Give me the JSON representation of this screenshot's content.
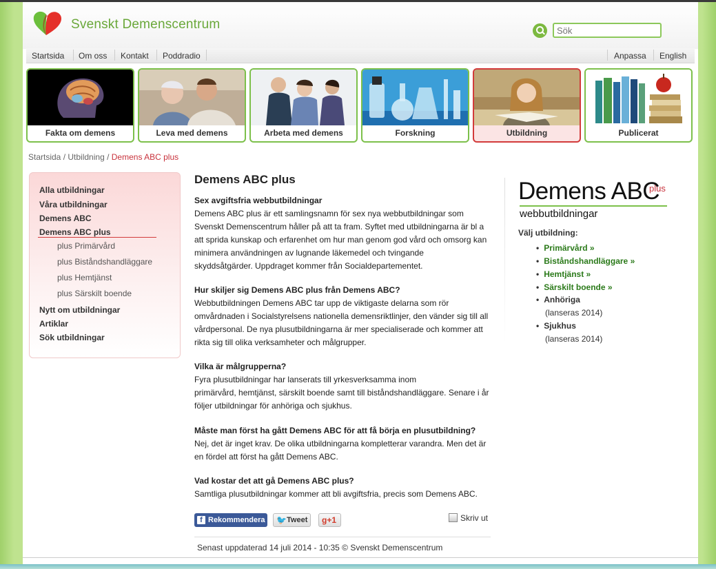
{
  "site": {
    "name": "Svenskt Demenscentrum"
  },
  "search": {
    "placeholder": "Sök"
  },
  "nav": {
    "left": [
      "Startsida",
      "Om oss",
      "Kontakt",
      "Poddradio"
    ],
    "right": [
      "Anpassa",
      "English"
    ]
  },
  "tiles": [
    {
      "label": "Fakta om demens",
      "icon": "brain-image"
    },
    {
      "label": "Leva med demens",
      "icon": "caregiver-image"
    },
    {
      "label": "Arbeta med demens",
      "icon": "nurses-image"
    },
    {
      "label": "Forskning",
      "icon": "lab-glassware-image"
    },
    {
      "label": "Utbildning",
      "icon": "student-image",
      "active": true
    },
    {
      "label": "Publicerat",
      "icon": "books-image"
    }
  ],
  "breadcrumb": {
    "items": [
      "Startsida",
      "Utbildning"
    ],
    "current": "Demens ABC plus",
    "sep": " / "
  },
  "leftmenu": {
    "items": [
      "Alla utbildningar",
      "Våra utbildningar",
      "Demens ABC",
      "Demens ABC plus"
    ],
    "subitems": [
      "plus Primärvård",
      "plus Biståndshandläggare",
      "plus Hemtjänst",
      "plus Särskilt boende"
    ],
    "items2": [
      "Nytt om utbildningar",
      "Artiklar",
      "Sök utbildningar"
    ]
  },
  "main": {
    "title": "Demens ABC plus",
    "sections": [
      {
        "heading": "Sex avgiftsfria webbutbildningar",
        "lines": [
          "Demens ABC plus är ett samlingsnamn för sex nya webbutbildningar som",
          "Svenskt Demenscentrum håller på att ta fram. Syftet med utbildningarna är bl a",
          "att sprida kunskap och erfarenhet om hur man genom god vård och omsorg kan",
          "minimera användningen av lugnande läkemedel och tvingande",
          "skyddsåtgärder. Uppdraget kommer från Socialdepartementet."
        ]
      },
      {
        "heading": "Hur skiljer sig Demens ABC plus från Demens ABC?",
        "lines": [
          "Webbutbildningen Demens ABC tar upp de viktigaste delarna som rör",
          "omvårdnaden i Socialstyrelsens nationella demensriktlinjer, den vänder sig till all",
          "vårdpersonal. De nya plusutbildningarna är mer specialiserade och kommer att",
          "rikta sig till olika verksamheter och målgrupper."
        ]
      },
      {
        "heading": "Vilka är målgrupperna?",
        "lines": [
          "Fyra plusutbildningar har lanserats till yrkesverksamma inom",
          "primärvård, hemtjänst, särskilt boende samt till biståndshandläggare. Senare i år",
          "följer utbildningar för anhöriga och sjukhus."
        ]
      },
      {
        "heading": "Måste man först ha gått Demens ABC för att få börja en plusutbildning?",
        "lines": [
          "Nej, det är inget krav. De olika utbildningarna kompletterar varandra. Men det är",
          "en fördel att först ha gått Demens ABC."
        ]
      },
      {
        "heading": "Vad kostar det att gå Demens ABC plus?",
        "lines": [
          "Samtliga plusutbildningar kommer att bli avgiftsfria, precis som Demens ABC."
        ]
      }
    ],
    "share": {
      "facebook": "Rekommendera",
      "twitter": "Tweet",
      "gplus": "g+1",
      "print": "Skriv ut"
    },
    "footer": "Senast uppdaterad 14 juli 2014 - 10:35 © Svenskt Demenscentrum"
  },
  "sidebar": {
    "logo_main": "Demens ABC",
    "logo_plus": "plus",
    "logo_sub": "webbutbildningar",
    "choose": "Välj utbildning:",
    "items": [
      {
        "label": "Primärvård »",
        "link": true
      },
      {
        "label": "Biståndshandläggare »",
        "link": true
      },
      {
        "label": "Hemtjänst »",
        "link": true
      },
      {
        "label": "Särskilt boende »",
        "link": true
      },
      {
        "label": "Anhöriga",
        "link": false,
        "note": "(lanseras 2014)"
      },
      {
        "label": "Sjukhus",
        "link": false,
        "note": "(lanseras 2014)"
      }
    ]
  },
  "colors": {
    "accent_green": "#7cc04a",
    "link_green": "#2b7a1a",
    "active_red": "#d23a3a"
  }
}
